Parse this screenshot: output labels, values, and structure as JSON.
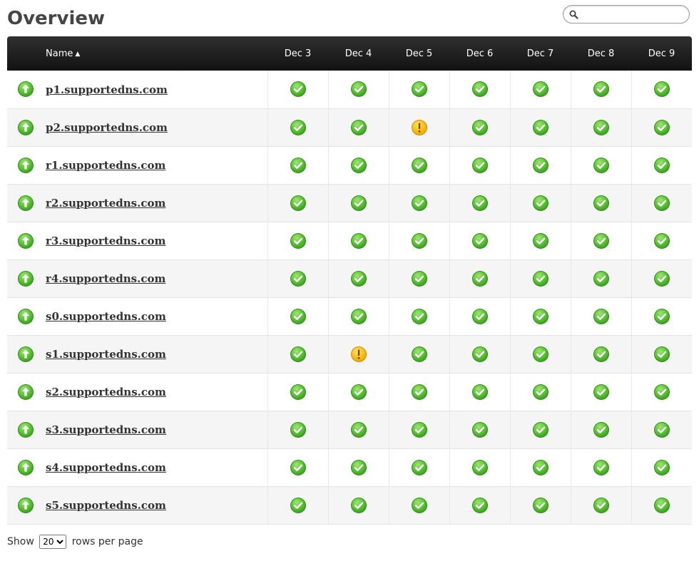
{
  "page": {
    "title": "Overview"
  },
  "search": {
    "placeholder": "",
    "value": ""
  },
  "table": {
    "name_header": "Name",
    "sort_indicator": "▲",
    "days": [
      "Dec 3",
      "Dec 4",
      "Dec 5",
      "Dec 6",
      "Dec 7",
      "Dec 8",
      "Dec 9"
    ],
    "rows": [
      {
        "host": "p1.supportedns.com",
        "state": "up",
        "statuses": [
          "ok",
          "ok",
          "ok",
          "ok",
          "ok",
          "ok",
          "ok"
        ]
      },
      {
        "host": "p2.supportedns.com",
        "state": "up",
        "statuses": [
          "ok",
          "ok",
          "warning",
          "ok",
          "ok",
          "ok",
          "ok"
        ]
      },
      {
        "host": "r1.supportedns.com",
        "state": "up",
        "statuses": [
          "ok",
          "ok",
          "ok",
          "ok",
          "ok",
          "ok",
          "ok"
        ]
      },
      {
        "host": "r2.supportedns.com",
        "state": "up",
        "statuses": [
          "ok",
          "ok",
          "ok",
          "ok",
          "ok",
          "ok",
          "ok"
        ]
      },
      {
        "host": "r3.supportedns.com",
        "state": "up",
        "statuses": [
          "ok",
          "ok",
          "ok",
          "ok",
          "ok",
          "ok",
          "ok"
        ]
      },
      {
        "host": "r4.supportedns.com",
        "state": "up",
        "statuses": [
          "ok",
          "ok",
          "ok",
          "ok",
          "ok",
          "ok",
          "ok"
        ]
      },
      {
        "host": "s0.supportedns.com",
        "state": "up",
        "statuses": [
          "ok",
          "ok",
          "ok",
          "ok",
          "ok",
          "ok",
          "ok"
        ]
      },
      {
        "host": "s1.supportedns.com",
        "state": "up",
        "statuses": [
          "ok",
          "warning",
          "ok",
          "ok",
          "ok",
          "ok",
          "ok"
        ]
      },
      {
        "host": "s2.supportedns.com",
        "state": "up",
        "statuses": [
          "ok",
          "ok",
          "ok",
          "ok",
          "ok",
          "ok",
          "ok"
        ]
      },
      {
        "host": "s3.supportedns.com",
        "state": "up",
        "statuses": [
          "ok",
          "ok",
          "ok",
          "ok",
          "ok",
          "ok",
          "ok"
        ]
      },
      {
        "host": "s4.supportedns.com",
        "state": "up",
        "statuses": [
          "ok",
          "ok",
          "ok",
          "ok",
          "ok",
          "ok",
          "ok"
        ]
      },
      {
        "host": "s5.supportedns.com",
        "state": "up",
        "statuses": [
          "ok",
          "ok",
          "ok",
          "ok",
          "ok",
          "ok",
          "ok"
        ]
      }
    ]
  },
  "pager": {
    "show_label": "Show",
    "rows_per_page": "20",
    "options": [
      "20"
    ],
    "suffix_label": "rows per page"
  },
  "icons": {
    "ok": "check-circle-icon",
    "warning": "exclamation-circle-icon",
    "up": "up-arrow-circle-icon"
  },
  "colors": {
    "ok_green": "#5cc93a",
    "warning_yellow": "#f5c400",
    "header_dark": "#1c1c1c",
    "row_alt": "#f5f5f5"
  }
}
